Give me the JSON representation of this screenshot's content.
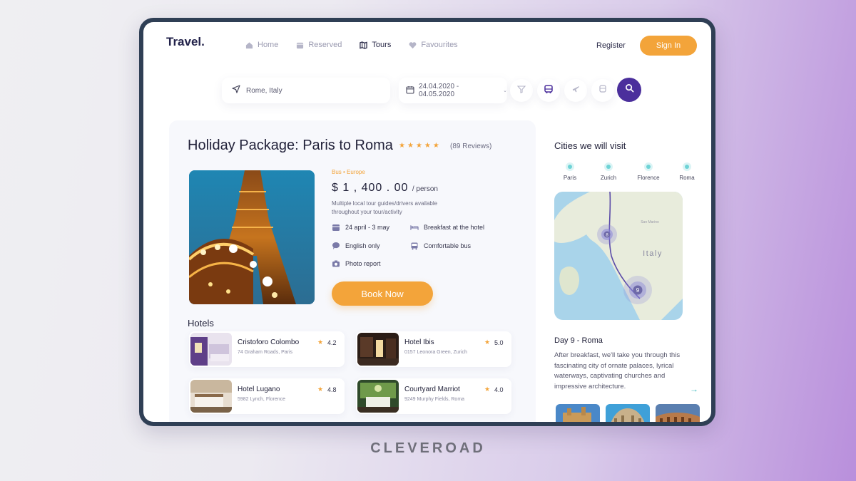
{
  "nav": {
    "logo": "Travel.",
    "links": [
      {
        "label": "Home",
        "icon": "home-icon"
      },
      {
        "label": "Reserved",
        "icon": "calendar-icon"
      },
      {
        "label": "Tours",
        "icon": "map-icon"
      },
      {
        "label": "Favourites",
        "icon": "heart-icon"
      }
    ],
    "active": "Tours",
    "register": "Register",
    "signin": "Sign In"
  },
  "search": {
    "location": "Rome, Italy",
    "dates": "24.04.2020 - 04.05.2020",
    "filters": [
      "filter-icon",
      "bus-icon",
      "plane-icon",
      "train-icon"
    ]
  },
  "package": {
    "title": "Holiday Package: Paris to Roma",
    "rating": 5,
    "reviews": "(89  Reviews)",
    "tag": "Bus  •  Europe",
    "price": "$ 1 , 400 . 00",
    "price_unit": "/ person",
    "description": "Multiple local tour guides/drivers available throughout your tour/activity",
    "features": [
      {
        "label": "24 april - 3 may",
        "icon": "calendar-icon"
      },
      {
        "label": "Breakfast at the hotel",
        "icon": "bed-icon"
      },
      {
        "label": "English only",
        "icon": "chat-icon"
      },
      {
        "label": "Comfortable bus",
        "icon": "bus-icon"
      },
      {
        "label": "Photo report",
        "icon": "camera-icon"
      }
    ],
    "book_label": "Book Now"
  },
  "hotels": {
    "title": "Hotels",
    "items": [
      {
        "name": "Cristoforo Colombo",
        "address": "74 Graham Roads, Paris",
        "rating": "4.2"
      },
      {
        "name": "Hotel Ibis",
        "address": "0157 Leonora Green, Zurich",
        "rating": "5.0"
      },
      {
        "name": "Hotel Lugano",
        "address": "5982 Lynch, Florence",
        "rating": "4.8"
      },
      {
        "name": "Courtyard Marriot",
        "address": "9249 Murphy Fields, Roma",
        "rating": "4.0"
      }
    ]
  },
  "cities": {
    "title": "Cities we will visit",
    "items": [
      "Paris",
      "Zurich",
      "Florence",
      "Roma"
    ]
  },
  "map": {
    "country_label": "Italy",
    "marker_a": "8",
    "marker_b": "9",
    "region_label": "San Marino"
  },
  "day": {
    "title": "Day 9 - Roma",
    "description": "After breakfast, we'll take you through this fascinating city of ornate palaces, lyrical waterways, captivating churches and impressive architecture."
  },
  "footer_brand": "CLEVEROAD",
  "colors": {
    "accent": "#f3a43a",
    "primary": "#4b2f9c",
    "teal": "#6ed3d6"
  }
}
